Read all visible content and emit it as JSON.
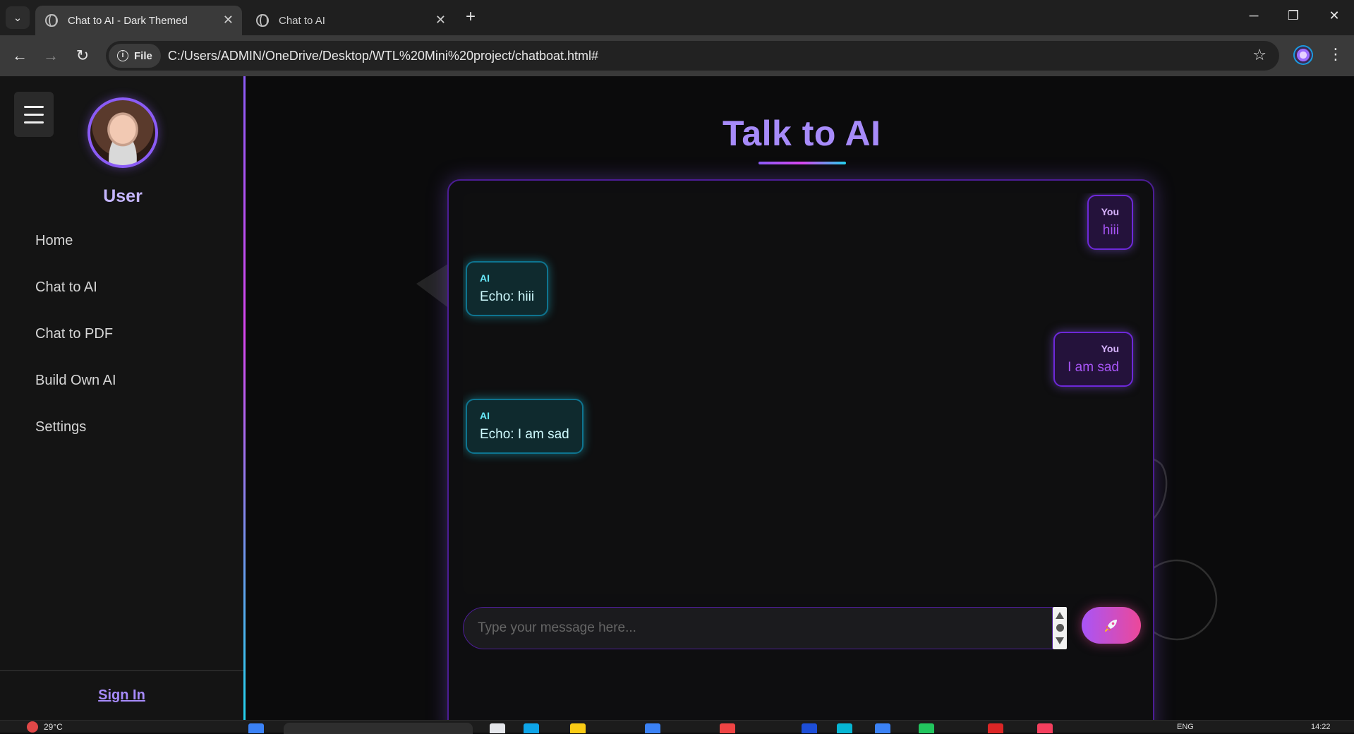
{
  "browser": {
    "tabs": [
      {
        "title": "Chat to AI - Dark Themed",
        "active": true
      },
      {
        "title": "Chat to AI",
        "active": false
      }
    ],
    "file_chip": "File",
    "url": "C:/Users/ADMIN/OneDrive/Desktop/WTL%20Mini%20project/chatboat.html#"
  },
  "sidebar": {
    "user_name": "User",
    "nav": [
      {
        "label": "Home"
      },
      {
        "label": "Chat to AI"
      },
      {
        "label": "Chat to PDF"
      },
      {
        "label": "Build Own AI"
      },
      {
        "label": "Settings"
      }
    ],
    "sign_in": "Sign In"
  },
  "main": {
    "title": "Talk to AI",
    "messages": [
      {
        "sender": "You",
        "text": "hiii",
        "role": "user"
      },
      {
        "sender": "AI",
        "text": "Echo: hiii",
        "role": "ai"
      },
      {
        "sender": "You",
        "text": "I am sad",
        "role": "user"
      },
      {
        "sender": "AI",
        "text": "Echo: I am sad",
        "role": "ai"
      }
    ],
    "input": {
      "placeholder": "Type your message here...",
      "value": ""
    },
    "send_icon": "rocket-icon"
  },
  "theme": {
    "accent": "#a78bfa",
    "user_bubble": "#24123b",
    "ai_bubble": "#0f2a2e",
    "gradient": [
      "#8b5cf6",
      "#d946ef",
      "#22d3ee"
    ]
  },
  "taskbar": {
    "temp": "29°C",
    "lang": "ENG",
    "time": "14:22"
  }
}
